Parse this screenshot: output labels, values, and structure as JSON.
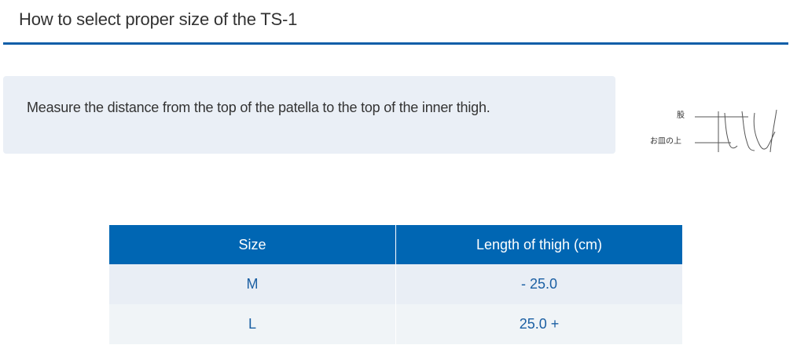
{
  "page": {
    "title": "How to select proper size of the TS-1"
  },
  "instruction": {
    "text": "Measure the distance from the top of the patella to the top of the inner thigh."
  },
  "diagram": {
    "label_thigh": "股",
    "label_patella": "お皿の上"
  },
  "size_table": {
    "headers": [
      "Size",
      "Length of thigh (cm)"
    ],
    "rows": [
      {
        "size": "M",
        "length": "- 25.0"
      },
      {
        "size": "L",
        "length": "25.0 +"
      }
    ]
  },
  "colors": {
    "accent": "#0066b3",
    "rule": "#0d5ea8",
    "box_background": "#eaeff6",
    "table_text": "#1b5fa3"
  }
}
